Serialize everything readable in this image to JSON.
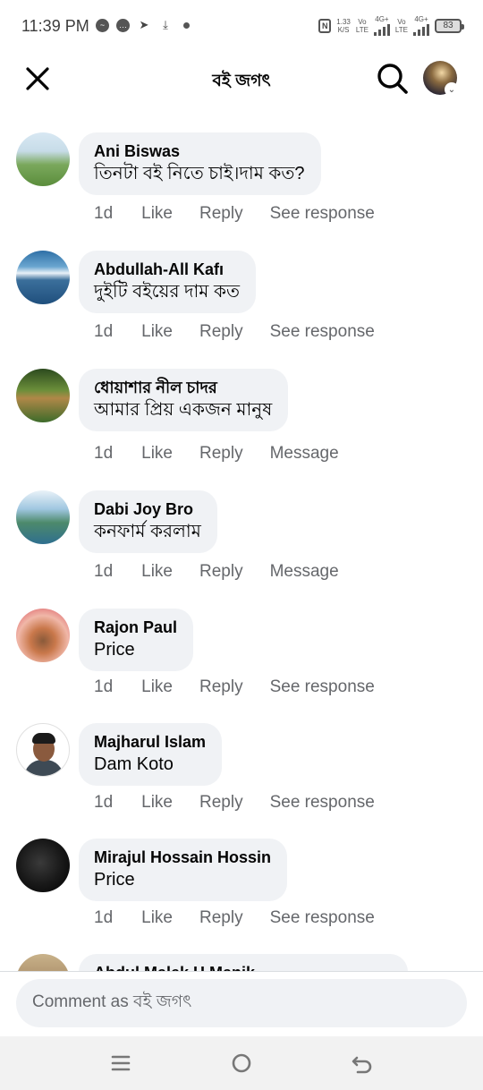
{
  "status_bar": {
    "time": "11:39 PM",
    "speed_top": "1.33",
    "speed_bottom": "K/S",
    "net1_top": "Vo",
    "net1_bottom": "LTE",
    "net1_type": "4G+",
    "net2_top": "Vo",
    "net2_bottom": "LTE",
    "net2_type": "4G+",
    "battery": "83"
  },
  "header": {
    "title": "বই জগৎ"
  },
  "comments": [
    {
      "author": "Ani Biswas",
      "text": "তিনটা বই নিতে চাই।দাম কত?",
      "time": "1d",
      "like": "Like",
      "reply": "Reply",
      "extra": "See response"
    },
    {
      "author": "Abdullah-All Kafı",
      "text": "দুইটি বইয়ের দাম কত",
      "time": "1d",
      "like": "Like",
      "reply": "Reply",
      "extra": "See response"
    },
    {
      "author": "ধোয়াশার নীল চাদর",
      "text": "আমার প্রিয় একজন মানুষ",
      "time": "1d",
      "like": "Like",
      "reply": "Reply",
      "extra": "Message"
    },
    {
      "author": "Dabi Joy Bro",
      "text": "কনফার্ম করলাম",
      "time": "1d",
      "like": "Like",
      "reply": "Reply",
      "extra": "Message"
    },
    {
      "author": "Rajon Paul",
      "text": "Price",
      "time": "1d",
      "like": "Like",
      "reply": "Reply",
      "extra": "See response"
    },
    {
      "author": "Majharul Islam",
      "text": "Dam Koto",
      "time": "1d",
      "like": "Like",
      "reply": "Reply",
      "extra": "See response"
    },
    {
      "author": "Mirajul Hossain Hossin",
      "text": "Price",
      "time": "1d",
      "like": "Like",
      "reply": "Reply",
      "extra": "See response"
    },
    {
      "author": "Abdul Malek H Manik",
      "text": "",
      "time": "",
      "like": "",
      "reply": "",
      "extra": ""
    }
  ],
  "composer": {
    "placeholder": "Comment as বই জগৎ"
  },
  "icons": {
    "close": "close-icon",
    "search": "search-icon",
    "nav_menu": "menu-icon",
    "nav_home": "home-icon",
    "nav_back": "back-icon"
  }
}
